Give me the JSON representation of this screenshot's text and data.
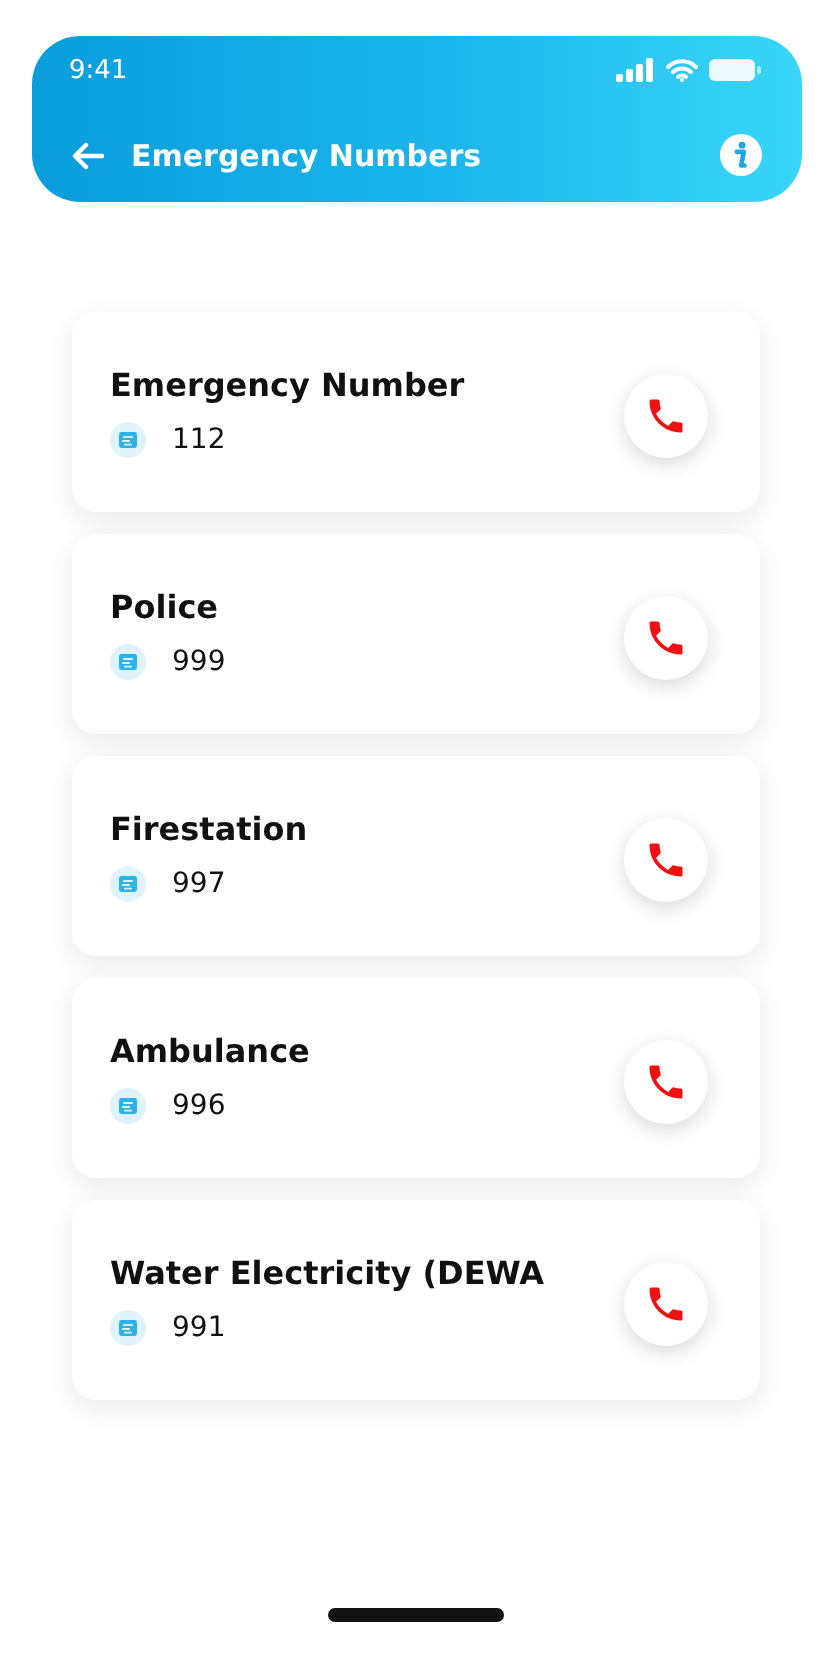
{
  "status_bar": {
    "time": "9:41"
  },
  "header": {
    "title": "Emergency Numbers"
  },
  "contacts": [
    {
      "name": "Emergency Number",
      "number": "112"
    },
    {
      "name": "Police",
      "number": "999"
    },
    {
      "name": "Firestation",
      "number": "997"
    },
    {
      "name": "Ambulance",
      "number": "996"
    },
    {
      "name": "Water Electricity (DEWA",
      "number": "991"
    }
  ]
}
